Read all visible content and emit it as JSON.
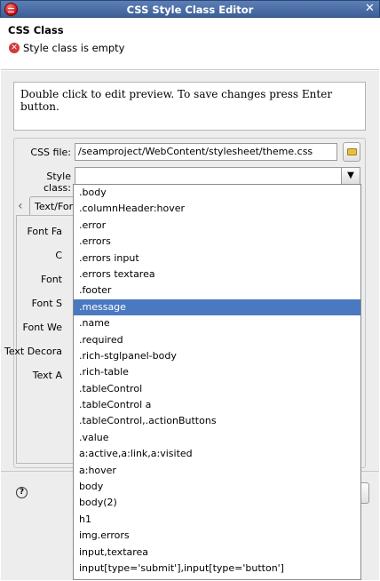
{
  "window": {
    "title": "CSS Style Class Editor"
  },
  "header": {
    "heading": "CSS Class",
    "message": "Style class is empty"
  },
  "preview": {
    "text": "Double click to edit preview. To save changes press Enter button."
  },
  "css_file": {
    "label": "CSS file:",
    "value": "/seamproject/WebContent/stylesheet/theme.css"
  },
  "style_class": {
    "label": "Style class:",
    "value": ""
  },
  "tabs": {
    "active_label": "Text/Font"
  },
  "properties": [
    {
      "label": "Font Fa"
    },
    {
      "label": "C"
    },
    {
      "label": "Font"
    },
    {
      "label": "Font S"
    },
    {
      "label": "Font We"
    },
    {
      "label": "Text Decora"
    },
    {
      "label": "Text A"
    }
  ],
  "dropdown": {
    "selected_index": 7,
    "items": [
      ".body",
      ".columnHeader:hover",
      ".error",
      ".errors",
      ".errors input",
      ".errors textarea",
      ".footer",
      ".message",
      ".name",
      ".required",
      ".rich-stglpanel-body",
      ".rich-table",
      ".tableControl",
      ".tableControl a",
      ".tableControl,.actionButtons",
      ".value",
      "a:active,a:link,a:visited",
      "a:hover",
      "body",
      "body(2)",
      "h1",
      "img.errors",
      "input,textarea",
      "input[type='submit'],input[type='button']"
    ]
  },
  "icons": {
    "app": "app-icon",
    "close": "close-icon",
    "error": "error-icon",
    "folder": "folder-icon",
    "chevron": "chevron-down-icon",
    "help": "help-icon"
  }
}
